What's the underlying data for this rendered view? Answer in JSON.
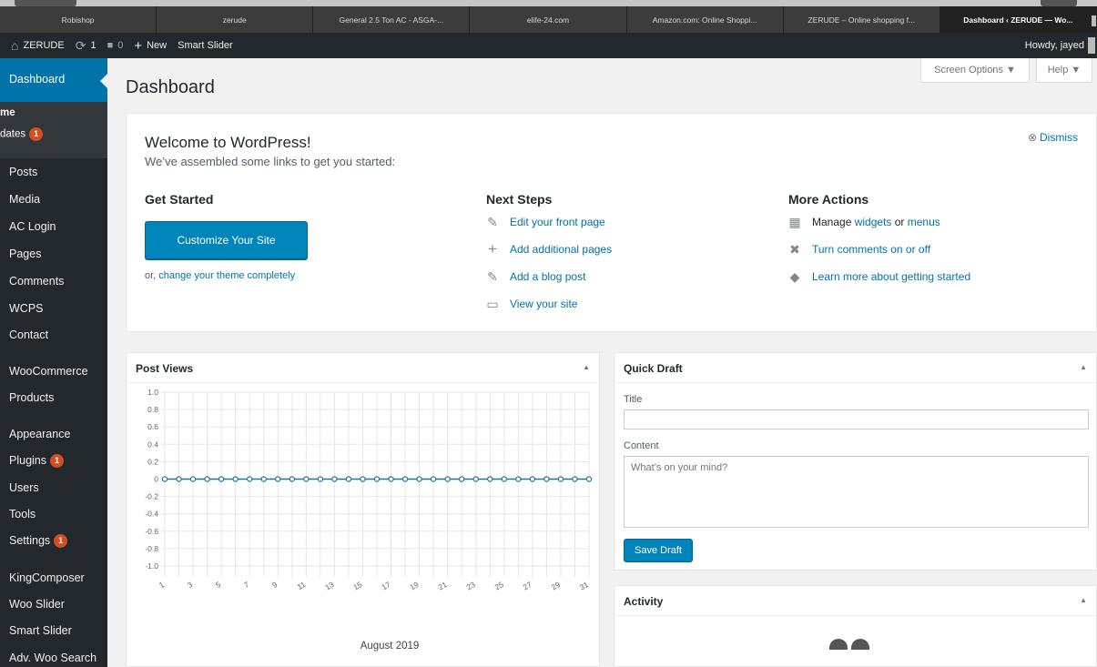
{
  "browser": {
    "tabs": [
      {
        "label": "Robishop"
      },
      {
        "label": "zerude"
      },
      {
        "label": "General 2.5 Ton AC - ASGA-..."
      },
      {
        "label": "elife-24.com"
      },
      {
        "label": "Amazon.com: Online Shoppi..."
      },
      {
        "label": "ZERUDE – Online shopping f..."
      },
      {
        "label": "Dashboard ‹ ZERUDE — Wo..."
      }
    ]
  },
  "adminbar": {
    "site_name": "ZERUDE",
    "updates_count": "1",
    "comments_count": "0",
    "new_label": "New",
    "smart_slider_label": "Smart Slider",
    "howdy": "Howdy, jayed"
  },
  "sidebar": {
    "current": "Dashboard",
    "submenu": {
      "home": "me",
      "updates": "dates",
      "updates_badge": "1"
    },
    "items": [
      {
        "label": "Posts"
      },
      {
        "label": "Media"
      },
      {
        "label": "AC Login"
      },
      {
        "label": "Pages"
      },
      {
        "label": "Comments"
      },
      {
        "label": "WCPS"
      },
      {
        "label": "Contact"
      },
      {
        "label": "WooCommerce"
      },
      {
        "label": "Products"
      },
      {
        "label": "Appearance"
      },
      {
        "label": "Plugins",
        "badge": "1"
      },
      {
        "label": "Users"
      },
      {
        "label": "Tools"
      },
      {
        "label": "Settings",
        "badge": "1"
      },
      {
        "label": "KingComposer"
      },
      {
        "label": "Woo Slider"
      },
      {
        "label": "Smart Slider"
      },
      {
        "label": "Adv. Woo Search"
      }
    ]
  },
  "screen_options": "Screen Options ▼",
  "help": "Help ▼",
  "page_title": "Dashboard",
  "welcome": {
    "title": "Welcome to WordPress!",
    "about": "We’ve assembled some links to get you started:",
    "dismiss": "Dismiss",
    "get_started": {
      "title": "Get Started",
      "button": "Customize Your Site",
      "or_prefix": "or,",
      "theme_link": "change your theme completely"
    },
    "next_steps": {
      "title": "Next Steps",
      "items": [
        {
          "label": "Edit your front page",
          "icon": "edit-page-icon"
        },
        {
          "label": "Add additional pages",
          "icon": "plus-icon"
        },
        {
          "label": "Add a blog post",
          "icon": "write-blog-icon"
        },
        {
          "label": "View your site",
          "icon": "view-site-icon"
        }
      ]
    },
    "more_actions": {
      "title": "More Actions",
      "manage_prefix": "Manage",
      "widgets": "widgets",
      "or_word": "or",
      "menus": "menus",
      "comments_toggle": "Turn comments on or off",
      "learn_more": "Learn more about getting started"
    }
  },
  "post_views": {
    "title": "Post Views",
    "toggle": "▲"
  },
  "quick_draft": {
    "title": "Quick Draft",
    "toggle": "▲",
    "title_label": "Title",
    "title_value": "",
    "content_label": "Content",
    "content_placeholder": "What’s on your mind?",
    "save_button": "Save Draft"
  },
  "activity": {
    "title": "Activity",
    "toggle": "▲"
  },
  "colors": {
    "admin_bar": "#23282d",
    "accent": "#0073aa",
    "button": "#0085ba",
    "badge": "#d54e21",
    "chart_line": "#21759b"
  },
  "chart_data": {
    "type": "line",
    "title": "",
    "xlabel": "August 2019",
    "ylabel": "",
    "x": [
      1,
      2,
      3,
      4,
      5,
      6,
      7,
      8,
      9,
      10,
      11,
      12,
      13,
      14,
      15,
      16,
      17,
      18,
      19,
      20,
      21,
      22,
      23,
      24,
      25,
      26,
      27,
      28,
      29,
      30,
      31
    ],
    "x_tick_labels": [
      "1",
      "3",
      "5",
      "7",
      "9",
      "11",
      "13",
      "15",
      "17",
      "19",
      "21",
      "23",
      "25",
      "27",
      "29",
      "31"
    ],
    "series": [
      {
        "values": [
          0,
          0,
          0,
          0,
          0,
          0,
          0,
          0,
          0,
          0,
          0,
          0,
          0,
          0,
          0,
          0,
          0,
          0,
          0,
          0,
          0,
          0,
          0,
          0,
          0,
          0,
          0,
          0,
          0,
          0,
          0
        ]
      }
    ],
    "ylim": [
      -1.0,
      1.0
    ],
    "y_ticks": [
      "1.0",
      "0.8",
      "0.6",
      "0.4",
      "0.2",
      "0",
      "-0.2",
      "-0.4",
      "-0.6",
      "-0.8",
      "-1.0"
    ],
    "grid": true
  }
}
